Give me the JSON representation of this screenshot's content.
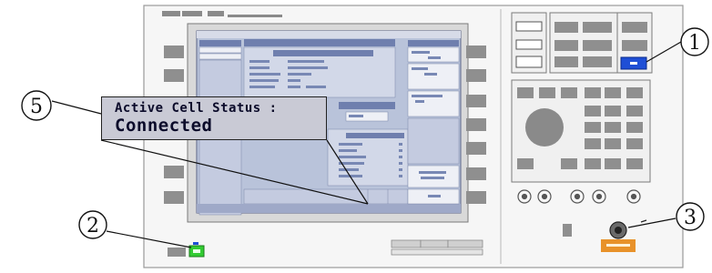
{
  "status_popup": {
    "title": "Active Cell Status :",
    "value": "Connected"
  },
  "callouts": [
    "1",
    "2",
    "3",
    "5"
  ],
  "colors": {
    "screen_bg": "#b9c3da",
    "panel_bg": "#f4f4f4",
    "key_dark": "#808080",
    "highlight_blue": "#1f4fd6",
    "highlight_green": "#33cc33",
    "highlight_orange": "#e8922a"
  }
}
